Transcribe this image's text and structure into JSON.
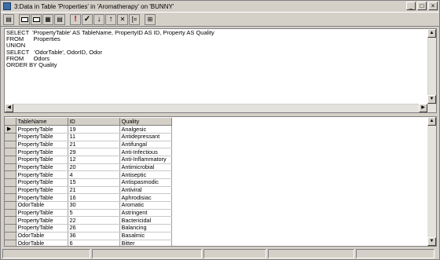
{
  "window": {
    "title": "3:Data in Table 'Properties' in 'Aromatherapy' on 'BUNNY'",
    "minimize_glyph": "_",
    "maximize_glyph": "□",
    "close_glyph": "×"
  },
  "toolbar": {
    "buttons": [
      {
        "name": "save-icon",
        "glyph": "▤"
      },
      {
        "name": "sql-pane-icon",
        "glyph": "▭"
      },
      {
        "name": "diagram-pane-icon",
        "glyph": "▭"
      },
      {
        "name": "grid-pane-icon",
        "glyph": "▦"
      },
      {
        "name": "results-pane-icon",
        "glyph": "▤"
      },
      {
        "name": "run-icon",
        "glyph": "!"
      },
      {
        "name": "verify-sql-icon",
        "glyph": "✓"
      },
      {
        "name": "sort-ascending-icon",
        "glyph": "↓"
      },
      {
        "name": "sort-descending-icon",
        "glyph": "↑"
      },
      {
        "name": "remove-filter-icon",
        "glyph": "✕"
      },
      {
        "name": "group-by-icon",
        "glyph": "[="
      },
      {
        "name": "add-table-icon",
        "glyph": "⊞"
      }
    ]
  },
  "sql": {
    "text": "SELECT  'PropertyTable' AS TableName, PropertyID AS ID, Property AS Quality\nFROM      Properties\nUNION\nSELECT   'OdorTable', OdorID, Odor\nFROM      Odors\nORDER BY Quality"
  },
  "grid": {
    "columns": [
      "TableName",
      "ID",
      "Quality"
    ],
    "current_row_marker": "▶",
    "rows": [
      [
        "PropertyTable",
        "19",
        "Analgesic"
      ],
      [
        "PropertyTable",
        "11",
        "Antidepressant"
      ],
      [
        "PropertyTable",
        "21",
        "Antifungal"
      ],
      [
        "PropertyTable",
        "29",
        "Anti-Infectious"
      ],
      [
        "PropertyTable",
        "12",
        "Anti-Inflammatory"
      ],
      [
        "PropertyTable",
        "20",
        "Antimicrobial"
      ],
      [
        "PropertyTable",
        "4",
        "Antiseptic"
      ],
      [
        "PropertyTable",
        "15",
        "Antispasmodic"
      ],
      [
        "PropertyTable",
        "21",
        "Antiviral"
      ],
      [
        "PropertyTable",
        "16",
        "Aphrodisiac"
      ],
      [
        "OdorTable",
        "30",
        "Aromatic"
      ],
      [
        "PropertyTable",
        "5",
        "Astringent"
      ],
      [
        "PropertyTable",
        "22",
        "Bactericidal"
      ],
      [
        "PropertyTable",
        "26",
        "Balancing"
      ],
      [
        "OdorTable",
        "36",
        "Basalmic"
      ],
      [
        "OdorTable",
        "6",
        "Bitter"
      ]
    ]
  },
  "scroll": {
    "up": "▲",
    "down": "▼",
    "left": "◀",
    "right": "▶"
  }
}
